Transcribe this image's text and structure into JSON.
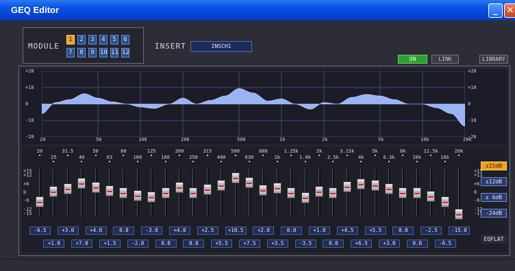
{
  "window": {
    "title": "GEQ Editor",
    "minimize_glyph": "_",
    "close_glyph": "✕"
  },
  "module": {
    "label": "MODULE",
    "buttons": [
      "1",
      "2",
      "3",
      "4",
      "5",
      "6",
      "7",
      "8",
      "9",
      "10",
      "11",
      "12"
    ],
    "selected": "1"
  },
  "insert": {
    "label": "INSERT",
    "value": "INSCH1"
  },
  "switches": {
    "on": "ON",
    "link": "LINK",
    "library": "LIBRARY"
  },
  "graph": {
    "db_ticks": [
      "+20",
      "+10",
      "0",
      "-10",
      "-20"
    ],
    "freq_ticks": [
      "20",
      "50",
      "100",
      "200",
      "500",
      "1k",
      "2k",
      "5k",
      "10k",
      "20k"
    ],
    "fill_color": "#9ab3f2"
  },
  "bands": {
    "freqs": [
      "20",
      "25",
      "31.5",
      "40",
      "50",
      "63",
      "80",
      "100",
      "125",
      "160",
      "200",
      "250",
      "315",
      "400",
      "500",
      "630",
      "800",
      "1k",
      "1.25k",
      "1.6k",
      "2k",
      "2.5k",
      "3.15k",
      "4k",
      "5k",
      "6.3k",
      "8k",
      "10k",
      "12.5k",
      "16k",
      "20k"
    ],
    "gains": [
      -6.5,
      1.0,
      3.0,
      7.0,
      4.0,
      1.5,
      0.0,
      -2.0,
      -3.0,
      0.0,
      4.0,
      0.0,
      2.5,
      5.5,
      10.5,
      7.5,
      2.0,
      3.5,
      0.0,
      -3.5,
      1.0,
      0.0,
      4.5,
      6.5,
      5.5,
      3.0,
      0.0,
      0.0,
      -2.5,
      -6.5,
      -15.0
    ],
    "gain_labels": [
      "-6.5",
      "+1.0",
      "+3.0",
      "+7.0",
      "+4.0",
      "+1.5",
      "0.0",
      "-2.0",
      "-3.0",
      "0.0",
      "+4.0",
      "0.0",
      "+2.5",
      "+5.5",
      "+10.5",
      "+7.5",
      "+2.0",
      "+3.5",
      "0.0",
      "-3.5",
      "+1.0",
      "0.0",
      "+4.5",
      "+6.5",
      "+5.5",
      "+3.0",
      "0.0",
      "0.0",
      "-2.5",
      "-6.5",
      "-15.0"
    ]
  },
  "fader_scale": [
    "+15",
    "+12",
    "+6",
    "0",
    "-6",
    "-12",
    "-15"
  ],
  "range_buttons": [
    "±15dB",
    "±12dB",
    "± 6dB",
    "-24dB"
  ],
  "range_selected": "±15dB",
  "eq_flat": "EQFLAT"
}
